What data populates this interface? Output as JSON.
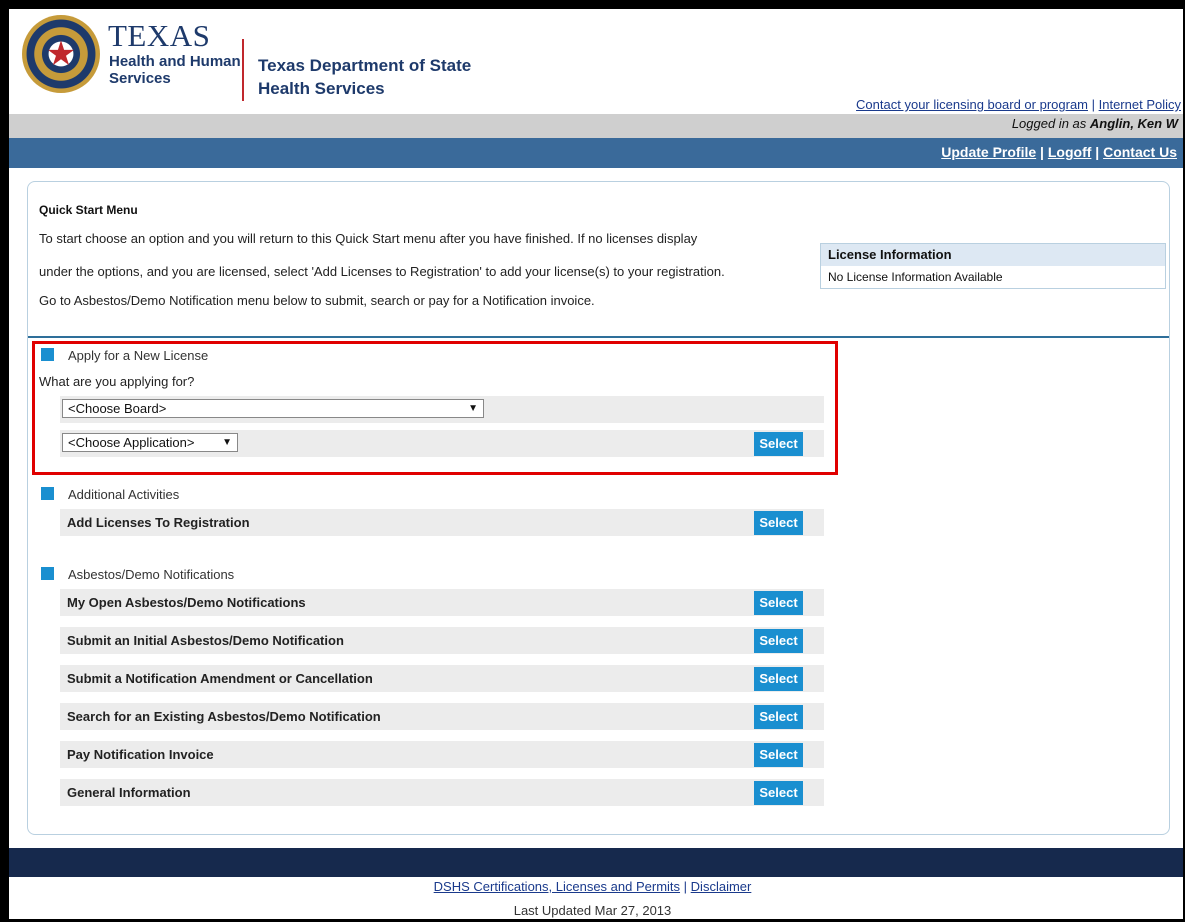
{
  "header": {
    "brand_texas": "TEXAS",
    "brand_hhs_line1": "Health and Human",
    "brand_hhs_line2": "Services",
    "brand_dshs_line1": "Texas Department of State",
    "brand_dshs_line2": "Health Services",
    "link_contact_board": "Contact your licensing board or program",
    "link_internet_policy": "Internet Policy",
    "logged_in_prefix": "Logged in as",
    "logged_in_user": "Anglin, Ken W"
  },
  "nav": {
    "update_profile": "Update Profile",
    "logoff": "Logoff",
    "contact_us": "Contact Us"
  },
  "quick_start": {
    "title": "Quick Start Menu",
    "line1": "To start choose an option and you will return to this Quick Start menu after you have finished. If no licenses display",
    "line2": "under the options, and you are licensed, select 'Add Licenses to Registration' to add your license(s) to your registration.",
    "line3": "Go to Asbestos/Demo Notification menu below to submit, search or pay for a Notification invoice."
  },
  "license_info": {
    "header": "License Information",
    "body": "No License Information Available"
  },
  "apply": {
    "title": "Apply for a New License",
    "question": "What are you applying for?",
    "board_select": "<Choose Board>",
    "application_select": "<Choose Application>",
    "select_label": "Select"
  },
  "additional": {
    "title": "Additional Activities",
    "items": [
      {
        "label": "Add Licenses To Registration",
        "button": "Select"
      }
    ]
  },
  "asbestos": {
    "title": "Asbestos/Demo Notifications",
    "items": [
      {
        "label": "My Open Asbestos/Demo Notifications",
        "button": "Select"
      },
      {
        "label": "Submit an Initial Asbestos/Demo Notification",
        "button": "Select"
      },
      {
        "label": "Submit a Notification Amendment or Cancellation",
        "button": "Select"
      },
      {
        "label": "Search for an Existing Asbestos/Demo Notification",
        "button": "Select"
      },
      {
        "label": "Pay Notification Invoice",
        "button": "Select"
      },
      {
        "label": "General Information",
        "button": "Select"
      }
    ]
  },
  "footer": {
    "link_dshs": "DSHS Certifications, Licenses and Permits",
    "link_disclaimer": "Disclaimer",
    "separator": "|",
    "last_updated": "Last Updated Mar 27, 2013"
  },
  "colors": {
    "accent_blue": "#1a8fd0",
    "nav_blue": "#3a6a9a",
    "footer_navy": "#16294d",
    "highlight_red": "#e00000"
  },
  "icons": {
    "seal": "texas-seal-icon",
    "section_marker": "blue-square-icon",
    "dropdown": "dropdown-caret-icon"
  }
}
